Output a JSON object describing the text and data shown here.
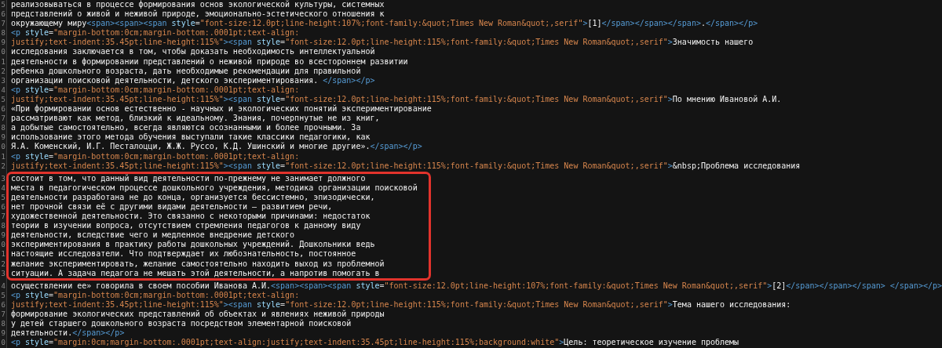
{
  "editor": {
    "blocks": [
      {
        "framed": false,
        "lines": [
          {
            "number": "5",
            "tokens": [
              {
                "kind": "text",
                "text": "реализовываться в процессе формирования основ экологической культуры, системных"
              }
            ]
          },
          {
            "number": "6",
            "tokens": [
              {
                "kind": "text",
                "text": "представлений о живой и неживой природе, эмоционально-эстетического отношения к"
              }
            ]
          },
          {
            "number": "7",
            "tokens": [
              {
                "kind": "text",
                "text": "окружающему миру"
              },
              {
                "kind": "tag",
                "text": "<span><span><span "
              },
              {
                "kind": "attr",
                "text": "style"
              },
              {
                "kind": "punct",
                "text": "="
              },
              {
                "kind": "value",
                "text": "\"font-size:12.0pt;line-height:107%;font-family:&quot;Times New Roman&quot;,serif\""
              },
              {
                "kind": "tag",
                "text": ">"
              },
              {
                "kind": "text",
                "text": "[1]"
              },
              {
                "kind": "tag",
                "text": "</span></span></span>"
              },
              {
                "kind": "text",
                "text": "."
              },
              {
                "kind": "tag",
                "text": "</span></p>"
              }
            ]
          },
          {
            "number": "8",
            "tokens": [
              {
                "kind": "tag",
                "text": "<p "
              },
              {
                "kind": "attr",
                "text": "style"
              },
              {
                "kind": "punct",
                "text": "="
              },
              {
                "kind": "value",
                "text": "\"margin-bottom:0cm;margin-bottom:.0001pt;text-align:"
              }
            ]
          },
          {
            "number": "9",
            "tokens": [
              {
                "kind": "value",
                "text": "justify;text-indent:35.45pt;line-height:115%\""
              },
              {
                "kind": "tag",
                "text": "><span "
              },
              {
                "kind": "attr",
                "text": "style"
              },
              {
                "kind": "punct",
                "text": "="
              },
              {
                "kind": "value",
                "text": "\"font-size:12.0pt;line-height:115%;font-family:&quot;Times New Roman&quot;,serif\""
              },
              {
                "kind": "tag",
                "text": ">"
              },
              {
                "kind": "text",
                "text": "Значимость нашего"
              }
            ]
          },
          {
            "number": "0",
            "tokens": [
              {
                "kind": "text",
                "text": "исследования заключается в том, чтобы доказать необходимость интеллектуальной"
              }
            ]
          },
          {
            "number": "1",
            "tokens": [
              {
                "kind": "text",
                "text": "деятельности в формировании представлений о неживой природе во всестороннем развитии"
              }
            ]
          },
          {
            "number": "2",
            "tokens": [
              {
                "kind": "text",
                "text": "ребенка дошкольного возраста, дать необходимые рекомендации для правильной"
              }
            ]
          },
          {
            "number": "3",
            "tokens": [
              {
                "kind": "text",
                "text": "организации поисковой деятельности, детского экспериментирования. "
              },
              {
                "kind": "tag",
                "text": "</span></p>"
              }
            ]
          },
          {
            "number": "4",
            "tokens": [
              {
                "kind": "tag",
                "text": "<p "
              },
              {
                "kind": "attr",
                "text": "style"
              },
              {
                "kind": "punct",
                "text": "="
              },
              {
                "kind": "value",
                "text": "\"margin-bottom:0cm;margin-bottom:.0001pt;text-align:"
              }
            ]
          },
          {
            "number": "5",
            "tokens": [
              {
                "kind": "value",
                "text": "justify;text-indent:35.45pt;line-height:115%\""
              },
              {
                "kind": "tag",
                "text": "><span "
              },
              {
                "kind": "attr",
                "text": "style"
              },
              {
                "kind": "punct",
                "text": "="
              },
              {
                "kind": "value",
                "text": "\"font-size:12.0pt;line-height:115%;font-family:&quot;Times New Roman&quot;,serif\""
              },
              {
                "kind": "tag",
                "text": ">"
              },
              {
                "kind": "text",
                "text": "По мнению Ивановой А.И."
              }
            ]
          },
          {
            "number": "6",
            "tokens": [
              {
                "kind": "text",
                "text": "«При формировании основ естественно - научных и экологических понятий экспериментирование"
              }
            ]
          },
          {
            "number": "7",
            "tokens": [
              {
                "kind": "text",
                "text": "рассматривают как метод, близкий к идеальному. Знания, почерпнутые не из книг,"
              }
            ]
          },
          {
            "number": "8",
            "tokens": [
              {
                "kind": "text",
                "text": "а добытые самостоятельно, всегда являются осознанными и более прочными. За"
              }
            ]
          },
          {
            "number": "9",
            "tokens": [
              {
                "kind": "text",
                "text": "использование этого метода обучения выступали такие классики педагогики, как"
              }
            ]
          },
          {
            "number": "0",
            "tokens": [
              {
                "kind": "text",
                "text": "Я.А. Коменский, И.Г. Песталоцци, Ж.Ж. Руссо, К.Д. Ушинский и многие другие»."
              },
              {
                "kind": "tag",
                "text": "</span></p>"
              }
            ]
          },
          {
            "number": "1",
            "tokens": [
              {
                "kind": "tag",
                "text": "<p "
              },
              {
                "kind": "attr",
                "text": "style"
              },
              {
                "kind": "punct",
                "text": "="
              },
              {
                "kind": "value",
                "text": "\"margin-bottom:0cm;margin-bottom:.0001pt;text-align:"
              }
            ]
          },
          {
            "number": "2",
            "tokens": [
              {
                "kind": "value",
                "text": "justify;text-indent:35.45pt;line-height:115%\""
              },
              {
                "kind": "tag",
                "text": "><span "
              },
              {
                "kind": "attr",
                "text": "style"
              },
              {
                "kind": "punct",
                "text": "="
              },
              {
                "kind": "value",
                "text": "\"font-size:12.0pt;line-height:115%;font-family:&quot;Times New Roman&quot;,serif\""
              },
              {
                "kind": "tag",
                "text": ">"
              },
              {
                "kind": "text",
                "text": "&nbsp;Проблема исследования"
              }
            ]
          }
        ]
      },
      {
        "framed": true,
        "lines": [
          {
            "number": "3",
            "tokens": [
              {
                "kind": "text",
                "text": "состоит в том, что данный вид деятельности по-прежнему не занимает должного"
              }
            ]
          },
          {
            "number": "4",
            "tokens": [
              {
                "kind": "text",
                "text": "места в педагогическом процессе дошкольного учреждения, методика организации поисковой"
              }
            ]
          },
          {
            "number": "5",
            "tokens": [
              {
                "kind": "text",
                "text": "деятельности разработана не до конца, организуется бессистемно, эпизодически,"
              }
            ]
          },
          {
            "number": "6",
            "tokens": [
              {
                "kind": "text",
                "text": "нет прочной связи её с другими видами деятельности – развитием речи,"
              }
            ]
          },
          {
            "number": "7",
            "tokens": [
              {
                "kind": "text",
                "text": "художественной деятельности. Это связанно с некоторыми причинами: недостаток"
              }
            ]
          },
          {
            "number": "8",
            "tokens": [
              {
                "kind": "text",
                "text": "теории в изучении вопроса, отсутствием стремления педагогов к данному виду"
              }
            ]
          },
          {
            "number": "9",
            "tokens": [
              {
                "kind": "text",
                "text": "деятельности, вследствие чего и медленное внедрение детского"
              }
            ]
          },
          {
            "number": "0",
            "tokens": [
              {
                "kind": "text",
                "text": "экспериментирования в практику работы дошкольных учреждений. Дошкольники ведь"
              }
            ]
          },
          {
            "number": "1",
            "tokens": [
              {
                "kind": "text",
                "text": "настоящие исследователи. Что подтверждает их любознательность, постоянное"
              }
            ]
          },
          {
            "number": "2",
            "tokens": [
              {
                "kind": "text",
                "text": "желание экспериментировать, желание самостоятельно находить выход из проблемной"
              }
            ]
          },
          {
            "number": "3",
            "tokens": [
              {
                "kind": "text",
                "text": "ситуации. А задача педагога не мешать этой деятельности, а напротив помогать в"
              }
            ]
          }
        ]
      },
      {
        "framed": false,
        "lines": [
          {
            "number": "4",
            "tokens": [
              {
                "kind": "text",
                "text": "осуществлении ее» говорила в своем пособии Иванова А.И."
              },
              {
                "kind": "tag",
                "text": "<span><span><span "
              },
              {
                "kind": "attr",
                "text": "style"
              },
              {
                "kind": "punct",
                "text": "="
              },
              {
                "kind": "value",
                "text": "\"font-size:12.0pt;line-height:107%;font-family:&quot;Times New Roman&quot;,serif\""
              },
              {
                "kind": "tag",
                "text": ">"
              },
              {
                "kind": "text",
                "text": "[2]"
              },
              {
                "kind": "tag",
                "text": "</span></span></span> </span></p>"
              }
            ]
          },
          {
            "number": "5",
            "tokens": [
              {
                "kind": "tag",
                "text": "<p "
              },
              {
                "kind": "attr",
                "text": "style"
              },
              {
                "kind": "punct",
                "text": "="
              },
              {
                "kind": "value",
                "text": "\"margin-bottom:0cm;margin-bottom:.0001pt;text-align:"
              }
            ]
          },
          {
            "number": "6",
            "tokens": [
              {
                "kind": "value",
                "text": "justify;text-indent:35.45pt;line-height:115%\""
              },
              {
                "kind": "tag",
                "text": "><span "
              },
              {
                "kind": "attr",
                "text": "style"
              },
              {
                "kind": "punct",
                "text": "="
              },
              {
                "kind": "value",
                "text": "\"font-size:12.0pt;line-height:115%;font-family:&quot;Times New Roman&quot;,serif\""
              },
              {
                "kind": "tag",
                "text": ">"
              },
              {
                "kind": "text",
                "text": "Тема нашего исследования:"
              }
            ]
          },
          {
            "number": "7",
            "tokens": [
              {
                "kind": "text",
                "text": "формирование экологических представлений об объектах и явлениях неживой природы"
              }
            ]
          },
          {
            "number": "8",
            "tokens": [
              {
                "kind": "text",
                "text": "у детей старшего дошкольного возраста посредством элементарной поисковой"
              }
            ]
          },
          {
            "number": "9",
            "tokens": [
              {
                "kind": "text",
                "text": "деятельности."
              },
              {
                "kind": "tag",
                "text": "</span></p>"
              }
            ]
          },
          {
            "number": "0",
            "tokens": [
              {
                "kind": "tag",
                "text": "<p "
              },
              {
                "kind": "attr",
                "text": "style"
              },
              {
                "kind": "punct",
                "text": "="
              },
              {
                "kind": "value",
                "text": "\"margin:0cm;margin-bottom:.0001pt;text-align:justify;text-indent:35.45pt;line-height:115%;background:white\""
              },
              {
                "kind": "tag",
                "text": ">"
              },
              {
                "kind": "text",
                "text": "Цель: теоретическое изучение проблемы"
              }
            ]
          }
        ]
      }
    ]
  }
}
